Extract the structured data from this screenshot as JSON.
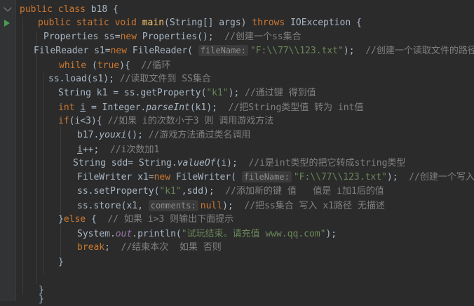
{
  "editor": {
    "language": "java",
    "lines": [
      {
        "indent": 6,
        "tokens": [
          [
            "kw",
            "public class "
          ],
          [
            "plain",
            "b18 {"
          ]
        ]
      },
      {
        "indent": 32,
        "tokens": [
          [
            "kw",
            "public static void "
          ],
          [
            "fn",
            "main"
          ],
          [
            "plain",
            "(String[] args) "
          ],
          [
            "kw",
            "throws "
          ],
          [
            "plain",
            "IOException {"
          ]
        ]
      },
      {
        "indent": 40,
        "tokens": [
          [
            "plain",
            "Properties ss="
          ],
          [
            "kw",
            "new "
          ],
          [
            "plain",
            "Properties();  "
          ],
          [
            "cmt",
            "//创建一个ss集合"
          ]
        ]
      },
      {
        "indent": 26,
        "tokens": [
          [
            "plain",
            "FileReader s1="
          ],
          [
            "kw",
            "new "
          ],
          [
            "plain",
            "FileReader( "
          ],
          [
            "hint",
            "fileName:"
          ],
          [
            "str",
            "\"F:\\\\77\\\\123.txt\""
          ],
          [
            "plain",
            ");  "
          ],
          [
            "cmt",
            "//创建一个读取文件的路径"
          ]
        ]
      },
      {
        "indent": 62,
        "tokens": [
          [
            "kw",
            "while "
          ],
          [
            "plain",
            "("
          ],
          [
            "kw",
            "true"
          ],
          [
            "plain",
            ")"
          ],
          [
            "plain",
            "{  "
          ],
          [
            "cmt",
            "//循环"
          ]
        ]
      },
      {
        "indent": 47,
        "tokens": [
          [
            "plain",
            "ss.load(s1); "
          ],
          [
            "cmt",
            "//读取文件到 SS集合"
          ]
        ]
      },
      {
        "indent": 61,
        "tokens": [
          [
            "plain",
            "String k1 = ss.getProperty("
          ],
          [
            "str",
            "\"k1\""
          ],
          [
            "plain",
            "); "
          ],
          [
            "cmt",
            "//通过键 得到值"
          ]
        ]
      },
      {
        "indent": 61,
        "tokens": [
          [
            "kw",
            "int "
          ],
          [
            "ul",
            "i"
          ],
          [
            "plain",
            " = Integer."
          ],
          [
            "it",
            "parseInt"
          ],
          [
            "plain",
            "(k1);  "
          ],
          [
            "cmt",
            "//把String类型值 转为 int值"
          ]
        ]
      },
      {
        "indent": 61,
        "tokens": [
          [
            "kw",
            "if"
          ],
          [
            "plain",
            "(i<"
          ],
          [
            "plain",
            "3){ "
          ],
          [
            "cmt",
            "//如果 i的次数小于3 则 调用游戏方法"
          ]
        ]
      },
      {
        "indent": 88,
        "tokens": [
          [
            "plain",
            "b17."
          ],
          [
            "it",
            "youxi"
          ],
          [
            "plain",
            "(); "
          ],
          [
            "cmt",
            "//游戏方法通过类名调用"
          ]
        ]
      },
      {
        "indent": 88,
        "tokens": [
          [
            "ul",
            "i"
          ],
          [
            "plain",
            "++;  "
          ],
          [
            "cmt",
            "//i次数加1"
          ]
        ]
      },
      {
        "indent": 82,
        "tokens": [
          [
            "plain",
            "String sdd= String."
          ],
          [
            "it",
            "valueOf"
          ],
          [
            "plain",
            "(i);  "
          ],
          [
            "cmt",
            "//i是int类型的把它转成string类型"
          ]
        ]
      },
      {
        "indent": 88,
        "tokens": [
          [
            "plain",
            "FileWriter x1="
          ],
          [
            "kw",
            "new "
          ],
          [
            "plain",
            "FileWriter( "
          ],
          [
            "hint",
            "fileName:"
          ],
          [
            "str",
            "\"F:\\\\77\\\\123.txt\""
          ],
          [
            "plain",
            ");  "
          ],
          [
            "cmt",
            "//创建一个写入路径"
          ]
        ]
      },
      {
        "indent": 88,
        "tokens": [
          [
            "plain",
            "ss.setProperty("
          ],
          [
            "str",
            "\"k1\""
          ],
          [
            "plain",
            ",sdd);  "
          ],
          [
            "cmt",
            "//添加新的键 值   值是 i加1后的值"
          ]
        ]
      },
      {
        "indent": 88,
        "tokens": [
          [
            "plain",
            "ss.store(x1, "
          ],
          [
            "hint",
            "comments:"
          ],
          [
            "kw",
            "null"
          ],
          [
            "plain",
            ");  "
          ],
          [
            "cmt",
            "//把ss集合 写入 x1路径 无描述"
          ]
        ]
      },
      {
        "indent": 61,
        "tokens": [
          [
            "plain",
            "}"
          ],
          [
            "kw",
            "else "
          ],
          [
            "plain",
            "{  "
          ],
          [
            "cmt",
            "// 如果 i>3 则输出下面提示"
          ]
        ]
      },
      {
        "indent": 88,
        "tokens": [
          [
            "plain",
            "System."
          ],
          [
            "field",
            "out"
          ],
          [
            "plain",
            ".println("
          ],
          [
            "str",
            "\"试玩结束。请充值 www.qq.com\""
          ],
          [
            "plain",
            ");"
          ]
        ]
      },
      {
        "indent": 88,
        "tokens": [
          [
            "kw",
            "break"
          ],
          [
            "plain",
            ";  "
          ],
          [
            "cmt",
            "//结束本次  如果 否则"
          ]
        ]
      },
      {
        "indent": 61,
        "tokens": [
          [
            "plain",
            "}"
          ]
        ]
      },
      {
        "indent": 0,
        "tokens": []
      },
      {
        "indent": 0,
        "tokens": []
      },
      {
        "indent": 33,
        "tokens": [
          [
            "plain",
            "}"
          ]
        ]
      },
      {
        "indent": 33,
        "tokens": [
          [
            "plain",
            "}"
          ]
        ]
      }
    ]
  }
}
